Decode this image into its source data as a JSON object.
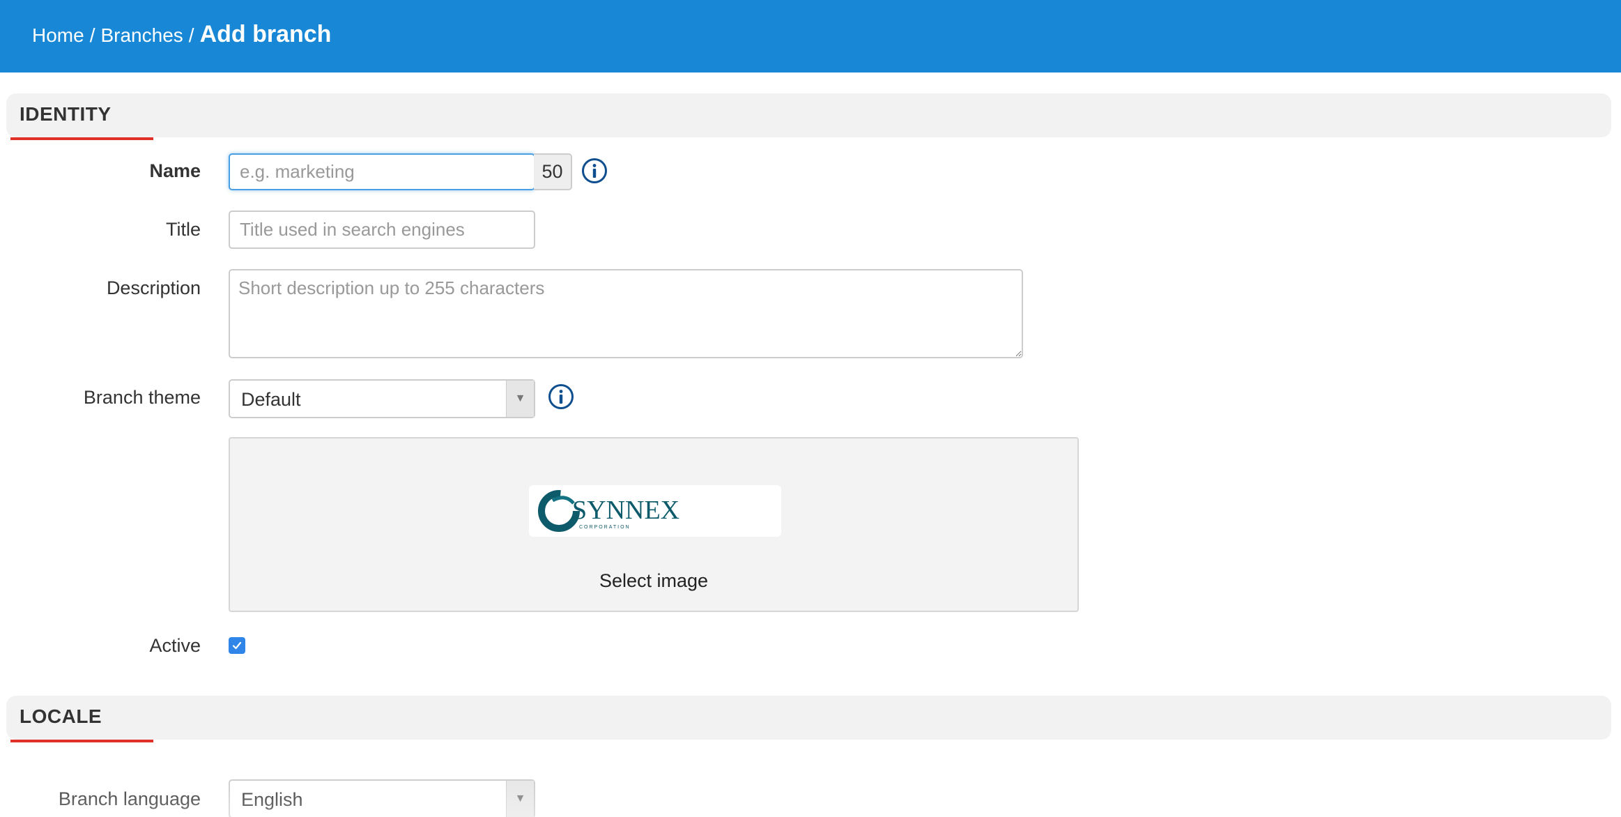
{
  "header": {
    "breadcrumb": [
      {
        "label": "Home"
      },
      {
        "label": "Branches"
      }
    ],
    "separator": "/",
    "current": "Add branch",
    "background_color": "#1787d6"
  },
  "sections": {
    "identity": {
      "title": "IDENTITY",
      "accent_color": "#e0302a"
    },
    "locale": {
      "title": "LOCALE",
      "accent_color": "#e0302a"
    }
  },
  "form": {
    "name": {
      "label": "Name",
      "placeholder": "e.g. marketing",
      "value": "",
      "char_counter": "50",
      "info_icon": "info-circle-icon"
    },
    "title": {
      "label": "Title",
      "placeholder": "Title used in search engines",
      "value": ""
    },
    "description": {
      "label": "Description",
      "placeholder": "Short description up to 255 characters",
      "value": ""
    },
    "branch_theme": {
      "label": "Branch theme",
      "selected": "Default",
      "info_icon": "info-circle-icon"
    },
    "image": {
      "select_label": "Select image",
      "logo_text": "SYNNEX",
      "logo_subtext": "CORPORATION"
    },
    "active": {
      "label": "Active",
      "checked": true
    },
    "branch_language": {
      "label": "Branch language",
      "selected": "English"
    }
  }
}
